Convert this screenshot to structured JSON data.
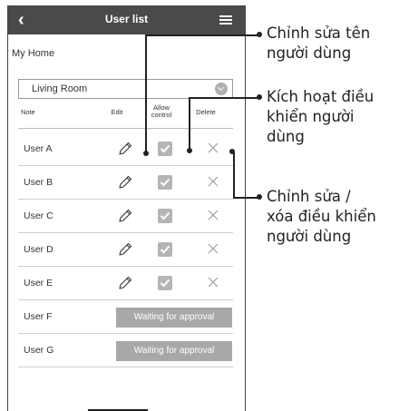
{
  "header": {
    "back_icon": "chevron-left-icon",
    "title": "User list",
    "menu_icon": "hamburger-menu-icon"
  },
  "home_label": "My Home",
  "room_select": {
    "value": "Living Room",
    "icon": "chevron-down-circle-icon"
  },
  "columns": {
    "note": "Note",
    "edit": "Edit",
    "allow": "Allow\ncontrol",
    "delete": "Delete"
  },
  "users": [
    {
      "name": "User A",
      "status": "approved",
      "allow_control": true
    },
    {
      "name": "User B",
      "status": "approved",
      "allow_control": true
    },
    {
      "name": "User C",
      "status": "approved",
      "allow_control": true
    },
    {
      "name": "User D",
      "status": "approved",
      "allow_control": true
    },
    {
      "name": "User E",
      "status": "approved",
      "allow_control": true
    },
    {
      "name": "User F",
      "status": "pending",
      "waiting_label": "Waiting for approval"
    },
    {
      "name": "User G",
      "status": "pending",
      "waiting_label": "Waiting for approval"
    }
  ],
  "callouts": {
    "edit_user": "Chỉnh sửa tên\nngười dùng",
    "allow_control": "Kích hoạt điều\nkhiển người\ndùng",
    "edit_delete": "Chỉnh sửa /\nxóa điều khiển\nngười dùng"
  },
  "colors": {
    "titlebar": "#4a4a4a",
    "checkbox": "#b5b5b5",
    "waiting_button": "#a8a8a8"
  }
}
